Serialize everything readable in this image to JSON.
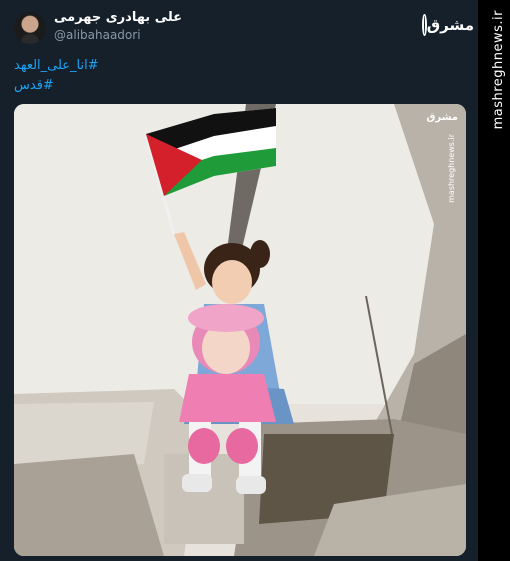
{
  "tweet": {
    "display_name": "علی بهادری جهرمی",
    "handle": "@alibahaadori",
    "hashtags": [
      "#انا_علی_العهد",
      "#قدس"
    ]
  },
  "branding": {
    "logo_text": "مشرق",
    "side_url": "mashreghnews.ir",
    "watermark_logo": "مشرق",
    "watermark_url": "mashreghnews.ir"
  },
  "colors": {
    "background": "#15202b",
    "hashtag": "#1da1f2",
    "handle": "#8899a6"
  },
  "media": {
    "icon": "photo-icon"
  }
}
